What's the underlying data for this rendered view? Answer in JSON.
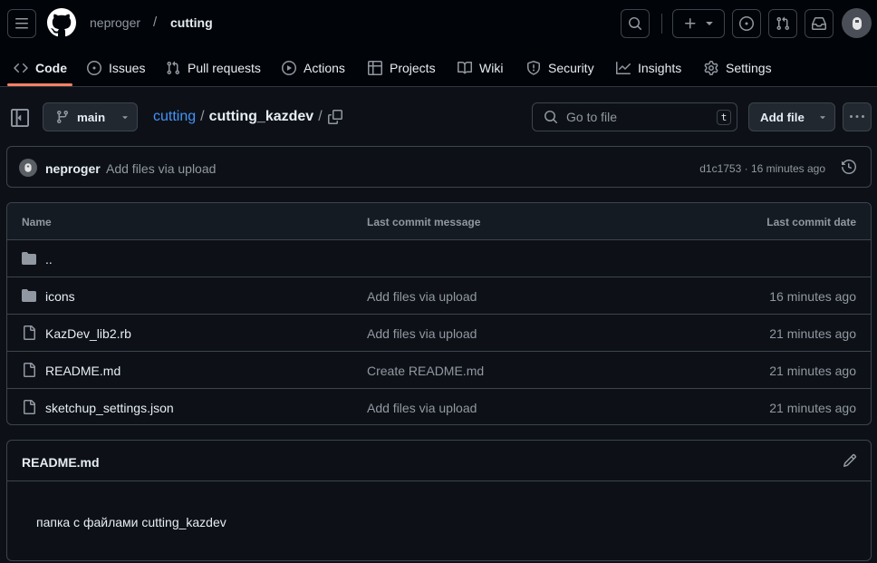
{
  "header": {
    "owner": "neproger",
    "separator": "/",
    "repo": "cutting"
  },
  "tabs": [
    {
      "label": "Code",
      "icon": "code-icon",
      "active": true
    },
    {
      "label": "Issues",
      "icon": "issue-icon"
    },
    {
      "label": "Pull requests",
      "icon": "pull-request-icon"
    },
    {
      "label": "Actions",
      "icon": "play-icon"
    },
    {
      "label": "Projects",
      "icon": "table-icon"
    },
    {
      "label": "Wiki",
      "icon": "book-icon"
    },
    {
      "label": "Security",
      "icon": "shield-icon"
    },
    {
      "label": "Insights",
      "icon": "graph-icon"
    },
    {
      "label": "Settings",
      "icon": "gear-icon"
    }
  ],
  "toolbar": {
    "branch": "main",
    "path_repo": "cutting",
    "path_sep": "/",
    "path_dir": "cutting_kazdev",
    "path_trail": "/",
    "goto_placeholder": "Go to file",
    "goto_shortcut": "t",
    "add_file_label": "Add file"
  },
  "commit": {
    "author": "neproger",
    "message": "Add files via upload",
    "meta": "d1c1753 · 16 minutes ago"
  },
  "table": {
    "headers": {
      "name": "Name",
      "message": "Last commit message",
      "date": "Last commit date"
    },
    "rows": [
      {
        "name": "..",
        "type": "folder",
        "message": "",
        "date": ""
      },
      {
        "name": "icons",
        "type": "folder",
        "message": "Add files via upload",
        "date": "16 minutes ago"
      },
      {
        "name": "KazDev_lib2.rb",
        "type": "file",
        "message": "Add files via upload",
        "date": "21 minutes ago"
      },
      {
        "name": "README.md",
        "type": "file",
        "message": "Create README.md",
        "date": "21 minutes ago"
      },
      {
        "name": "sketchup_settings.json",
        "type": "file",
        "message": "Add files via upload",
        "date": "21 minutes ago"
      }
    ]
  },
  "readme": {
    "title": "README.md",
    "body": "папка с файлами cutting_kazdev"
  },
  "colors": {
    "background": "#0d1117",
    "header_bg": "#010409",
    "border": "#3d444d",
    "link": "#4493f8",
    "tab_underline": "#f78166",
    "muted_text": "#9198a1"
  }
}
